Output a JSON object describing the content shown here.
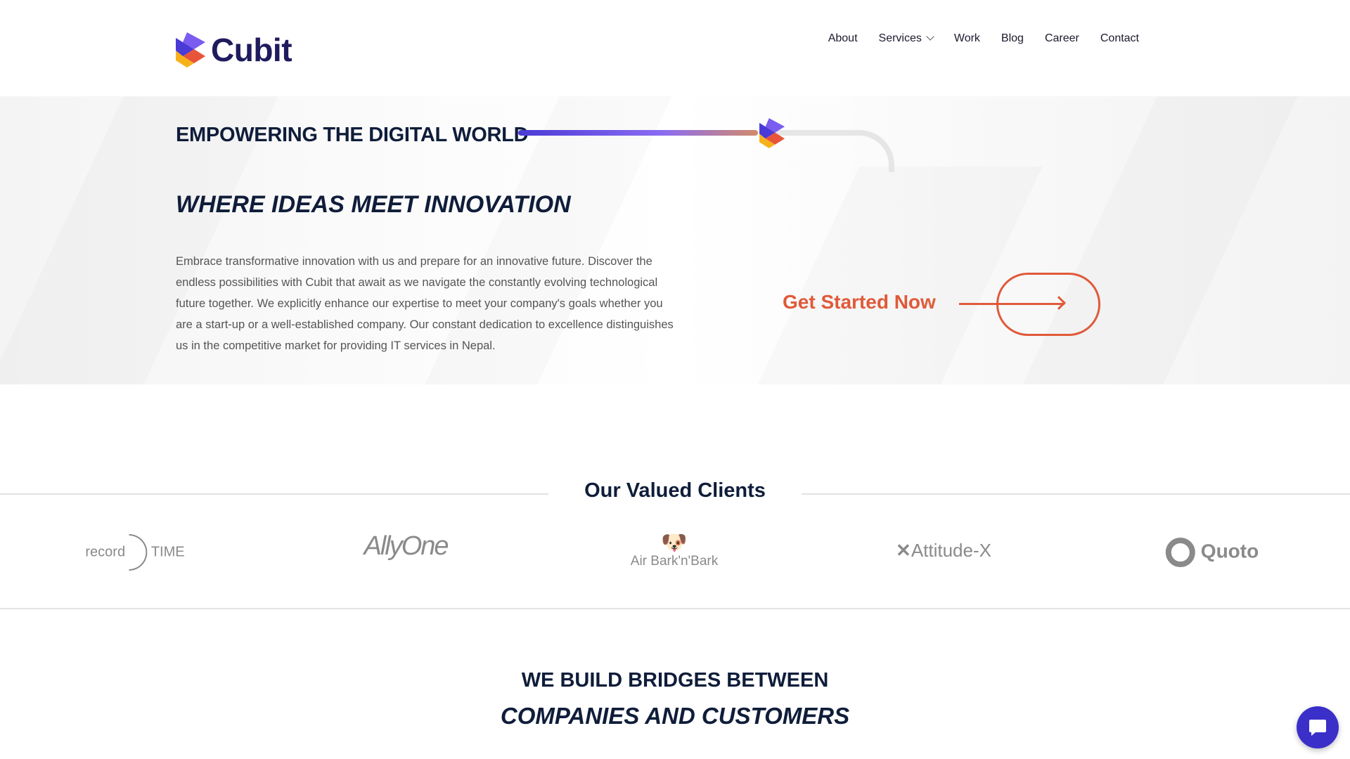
{
  "brand": {
    "name": "Cubit",
    "colors": {
      "primary": "#1e1b5e",
      "accent": "#e05a3a",
      "purple": "#4a3ad6"
    }
  },
  "nav": {
    "items": [
      {
        "label": "About"
      },
      {
        "label": "Services",
        "has_dropdown": true
      },
      {
        "label": "Work"
      },
      {
        "label": "Blog"
      },
      {
        "label": "Career"
      },
      {
        "label": "Contact"
      }
    ]
  },
  "hero": {
    "tagline": "EMPOWERING THE DIGITAL WORLD",
    "headline": "WHERE IDEAS MEET INNOVATION",
    "body": "Embrace transformative innovation with us and prepare for an innovative future. Discover the endless possibilities with Cubit that await as we navigate the constantly evolving technological future together. We explicitly enhance our expertise to meet your company's goals whether you are a start-up or a well-established company. Our constant dedication to excellence distinguishes us in the competitive market for providing IT services in Nepal.",
    "cta_label": "Get Started Now"
  },
  "clients": {
    "title": "Our Valued Clients",
    "logos": [
      {
        "name": "record TIME",
        "a": "record",
        "b": "TIME"
      },
      {
        "name": "AllyOne"
      },
      {
        "name": "Air Bark'n'Bark"
      },
      {
        "name": "Attitude-X"
      },
      {
        "name": "Quoto"
      }
    ]
  },
  "bridges": {
    "line1": "WE BUILD BRIDGES BETWEEN",
    "line2": "COMPANIES AND CUSTOMERS"
  },
  "chat": {
    "icon": "chat-bubble-icon"
  }
}
